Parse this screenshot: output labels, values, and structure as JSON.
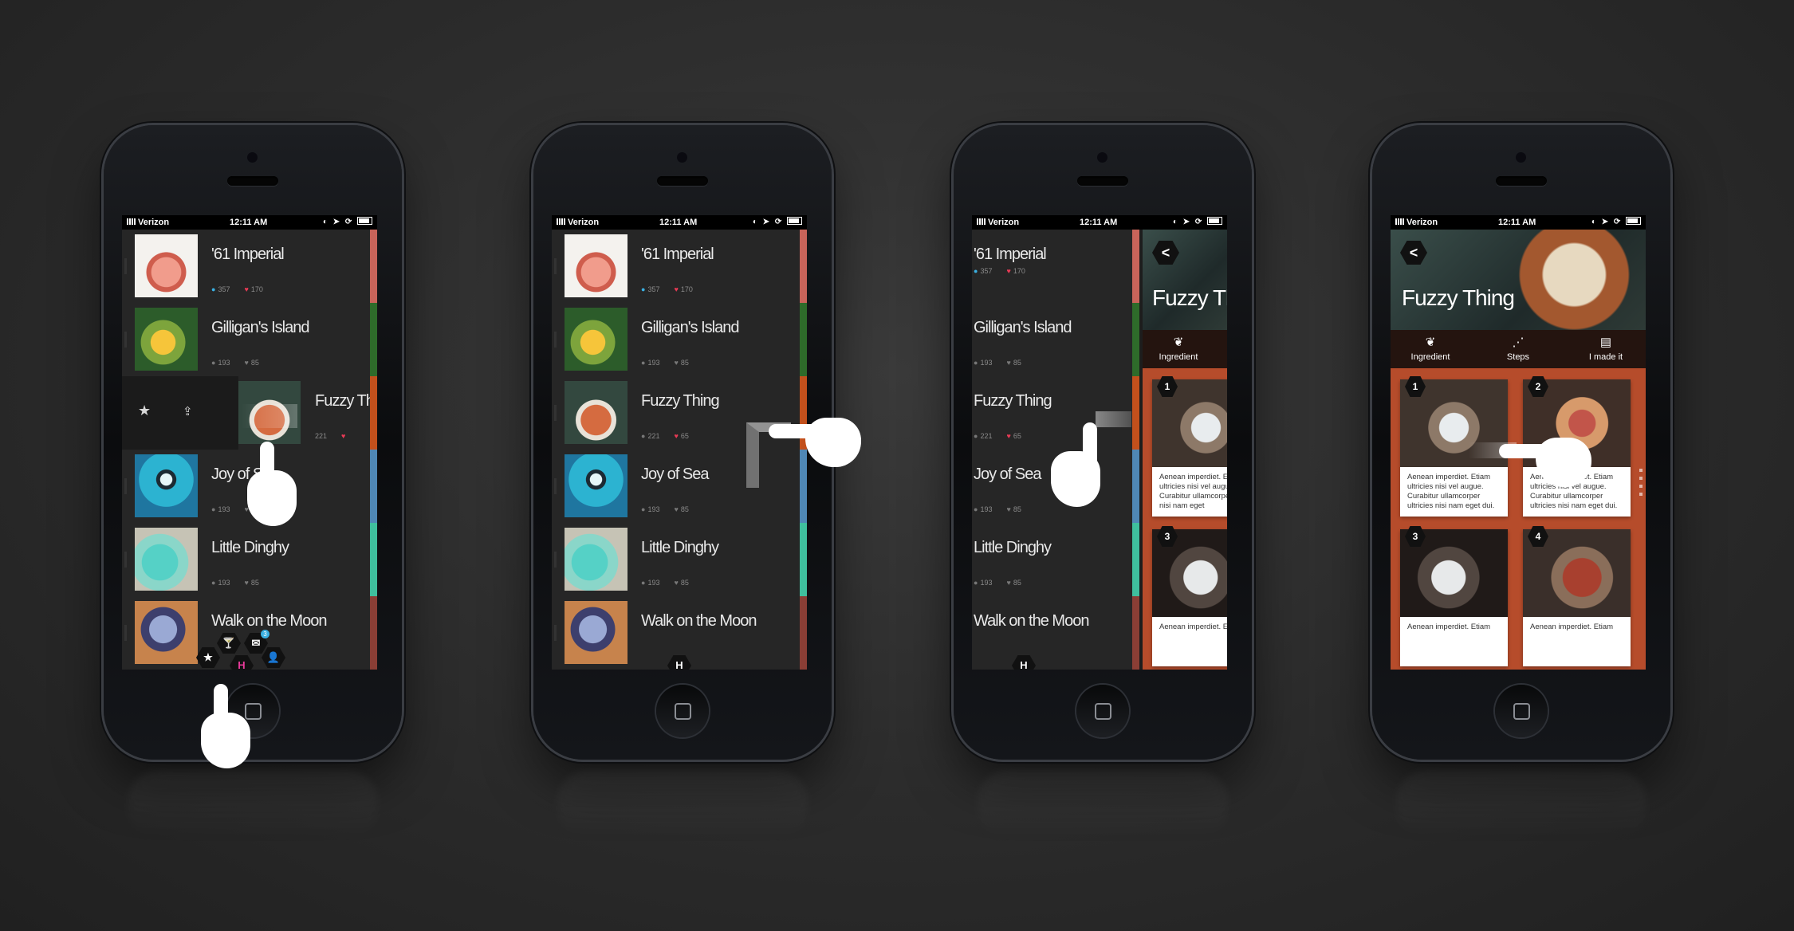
{
  "status": {
    "carrier": "Verizon",
    "time": "12:11 AM"
  },
  "drinks": [
    {
      "name": "'61 Imperial",
      "comments": "357",
      "likes": "170",
      "color": "#c8645a"
    },
    {
      "name": "Gilligan's Island",
      "comments": "193",
      "likes": "85",
      "color": "#2e6b2a"
    },
    {
      "name": "Fuzzy Thing",
      "comments": "221",
      "likes": "65",
      "color": "#c2501c"
    },
    {
      "name": "Joy of Sea",
      "comments": "193",
      "likes": "85",
      "color": "#4f87b5"
    },
    {
      "name": "Little Dinghy",
      "comments": "193",
      "likes": "85",
      "color": "#3fbf9d"
    },
    {
      "name": "Walk on the Moon",
      "comments": "193",
      "likes": "85",
      "color": "#8a3e35"
    }
  ],
  "swipe": {
    "title_partial": "Fuzzy Thi",
    "comments": "221",
    "star": "★",
    "share": "⇪"
  },
  "menu": {
    "badge": "3",
    "logo": "H"
  },
  "detail": {
    "title": "Fuzzy Thing",
    "title_partial": "Fuzzy Thi",
    "back": "<",
    "tabs": [
      {
        "label": "Ingredient",
        "icon": "❦"
      },
      {
        "label": "Steps",
        "icon": "⋰"
      },
      {
        "label": "I made it",
        "icon": "▤"
      }
    ],
    "steps": [
      {
        "num": "1",
        "text": "Aenean imperdiet. Etiam ultricies nisi vel augue. Curabitur ullamcorper ultricies nisi nam eget dui."
      },
      {
        "num": "2",
        "text": "Aenean imperdiet. Etiam ultricies nisi vel augue. Curabitur ullamcorper ultricies nisi nam eget dui."
      },
      {
        "num": "3",
        "text": "Aenean imperdiet. Etiam"
      },
      {
        "num": "4",
        "text": "Aenean imperdiet. Etiam"
      }
    ],
    "partial_step_text": "Aenean imperdiet. Et ultricies nisi vel augu Curabitur ullamcorpe tricies nisi nam eget",
    "partial_step3_text": "Aenean imperdiet. Et"
  }
}
